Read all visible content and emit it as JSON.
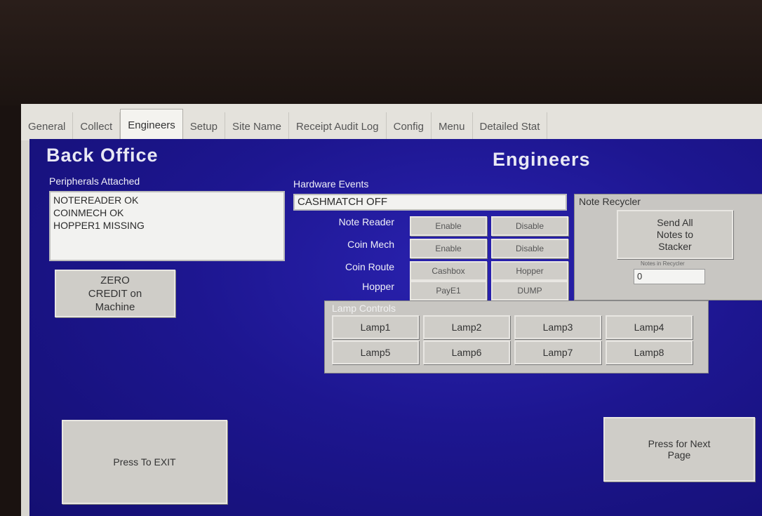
{
  "tabs": [
    "General",
    "Collect",
    "Engineers",
    "Setup",
    "Site Name",
    "Receipt Audit Log",
    "Config",
    "Menu",
    "Detailed Stat"
  ],
  "active_tab_index": 2,
  "header": {
    "left_title": "Back Office",
    "right_title": "Engineers"
  },
  "peripherals": {
    "label": "Peripherals Attached",
    "items": [
      "NOTEREADER OK",
      "COINMECH OK",
      "HOPPER1 MISSING"
    ]
  },
  "zero_button": {
    "line1": "ZERO",
    "line2": "CREDIT on",
    "line3": "Machine"
  },
  "hardware": {
    "label": "Hardware Events",
    "event_value": "CASHMATCH OFF",
    "rows": [
      {
        "label": "Note Reader",
        "btn1": "Enable",
        "btn2": "Disable"
      },
      {
        "label": "Coin Mech",
        "btn1": "Enable",
        "btn2": "Disable"
      },
      {
        "label": "Coin Route",
        "btn1": "Cashbox",
        "btn2": "Hopper"
      },
      {
        "label": "Hopper",
        "btn1": "PayE1",
        "btn2": "DUMP"
      }
    ]
  },
  "recycler": {
    "title": "Note Recycler",
    "send_line1": "Send All",
    "send_line2": "Notes to",
    "send_line3": "Stacker",
    "count_label": "Notes in Recycler",
    "count_value": "0"
  },
  "lamps": {
    "title": "Lamp Controls",
    "items": [
      "Lamp1",
      "Lamp2",
      "Lamp3",
      "Lamp4",
      "Lamp5",
      "Lamp6",
      "Lamp7",
      "Lamp8"
    ]
  },
  "exit_button": "Press To EXIT",
  "next_button": {
    "line1": "Press for Next",
    "line2": "Page"
  }
}
